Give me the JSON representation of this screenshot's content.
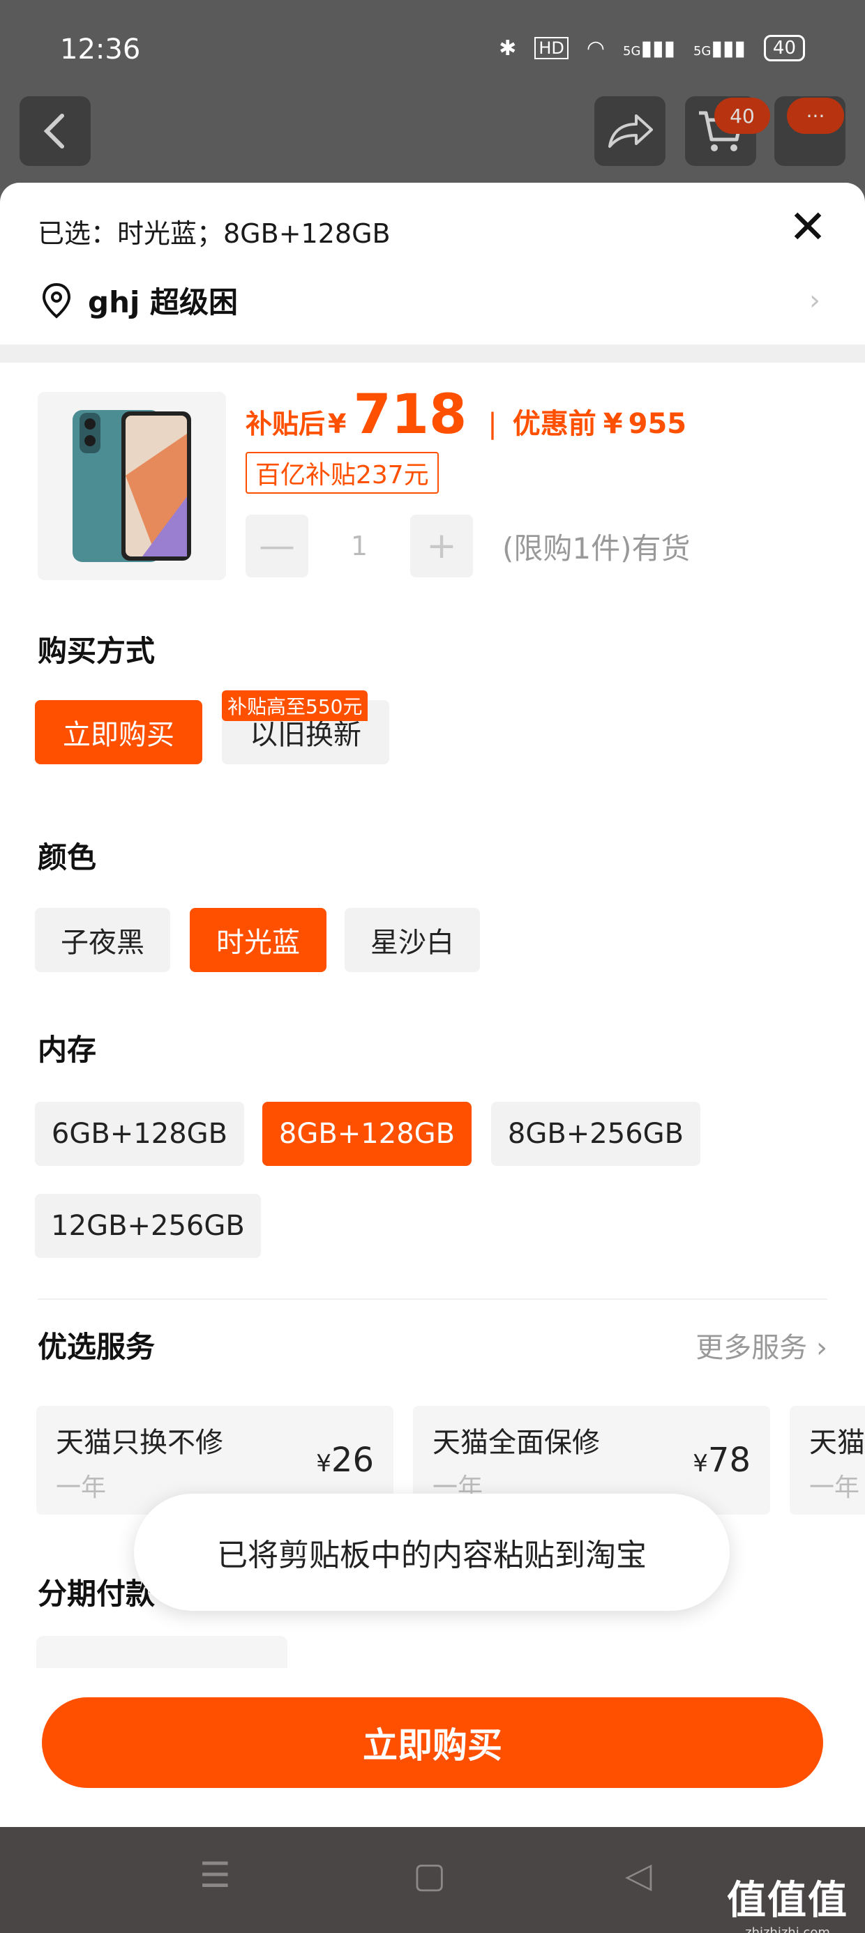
{
  "status_bar": {
    "time": "12:36",
    "hd": "HD",
    "net1": "5G",
    "net2": "5G",
    "battery": "40"
  },
  "top_nav": {
    "cart_badge": "40",
    "more_badge": "···"
  },
  "sheet": {
    "selected_text": "已选：时光蓝；8GB+128GB",
    "address": "ghj 超级困",
    "price": {
      "after_label": "补贴后",
      "currency": "¥",
      "after_value": "718",
      "separator": "|",
      "before_label": "优惠前",
      "before_value": "955"
    },
    "subsidy_tag": "百亿补贴237元",
    "quantity": {
      "minus": "—",
      "value": "1",
      "plus": "+",
      "stock_text": "(限购1件)有货"
    },
    "purchase": {
      "title": "购买方式",
      "options": [
        "立即购买",
        "以旧换新"
      ],
      "trade_in_tag": "补贴高至550元"
    },
    "color": {
      "title": "颜色",
      "options": [
        "子夜黑",
        "时光蓝",
        "星沙白"
      ]
    },
    "memory": {
      "title": "内存",
      "options": [
        "6GB+128GB",
        "8GB+128GB",
        "8GB+256GB",
        "12GB+256GB"
      ]
    },
    "services": {
      "title": "优选服务",
      "more": "更多服务",
      "items": [
        {
          "name": "天猫只换不修",
          "term": "一年",
          "currency": "¥",
          "price": "26"
        },
        {
          "name": "天猫全面保修",
          "term": "一年",
          "currency": "¥",
          "price": "78"
        },
        {
          "name": "天猫",
          "term": "一年"
        }
      ]
    },
    "installment_title": "分期付款",
    "toast": "已将剪贴板中的内容粘贴到淘宝",
    "buy_button": "立即购买"
  },
  "watermark": {
    "text": "值值值",
    "site": "zhizhizhi.com"
  },
  "colors": {
    "accent": "#ff5000",
    "chip_bg": "#f2f2f2"
  }
}
